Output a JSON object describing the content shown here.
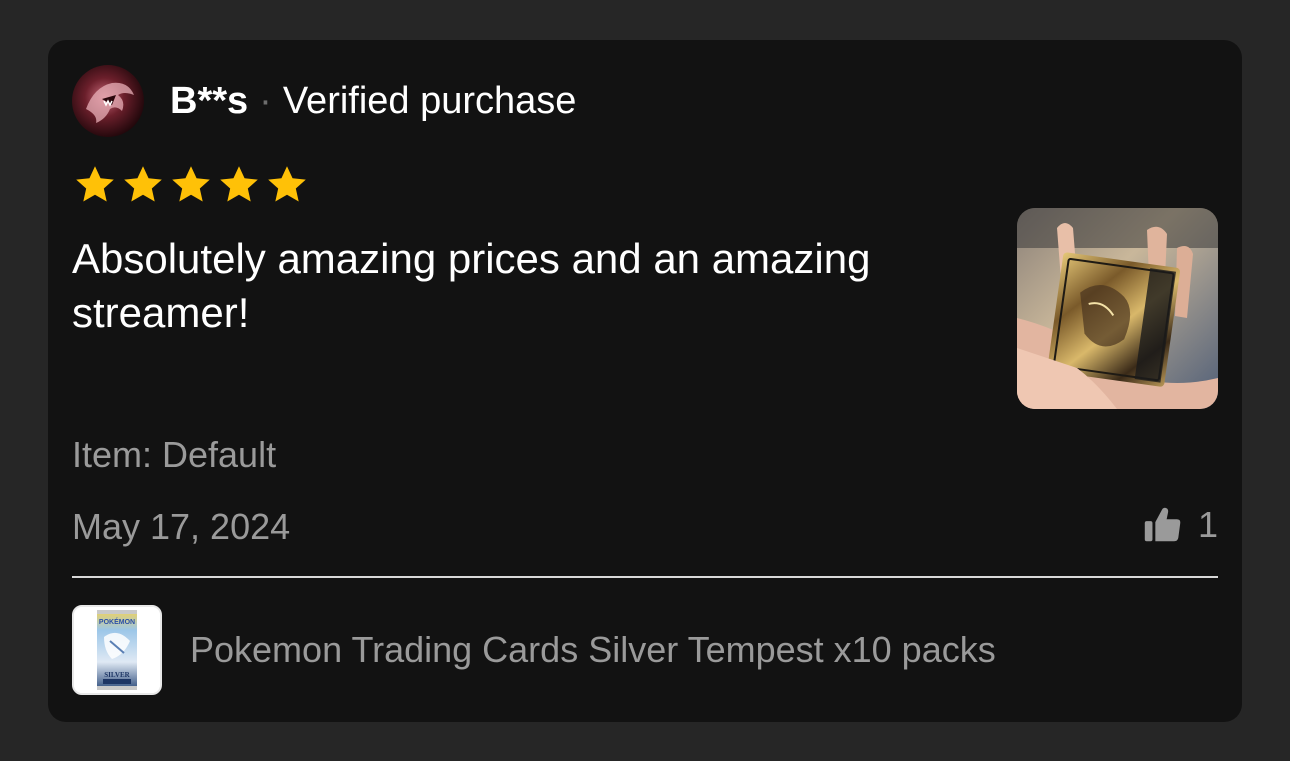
{
  "review": {
    "username": "B**s",
    "separator": "·",
    "verified_label": "Verified purchase",
    "rating": 5,
    "rating_max": 5,
    "text": "Absolutely amazing prices and an amazing streamer!",
    "item": "Item: Default",
    "date": "May 17, 2024",
    "helpful_count": "1",
    "star_color": "#FFC107"
  },
  "product": {
    "name": "Pokemon Trading Cards Silver Tempest x10 packs",
    "thumb_text_1": "POKÉMON",
    "thumb_text_2": "SILVER"
  },
  "icons": {
    "helpful": "thumbs-up-icon",
    "star": "star-icon"
  }
}
